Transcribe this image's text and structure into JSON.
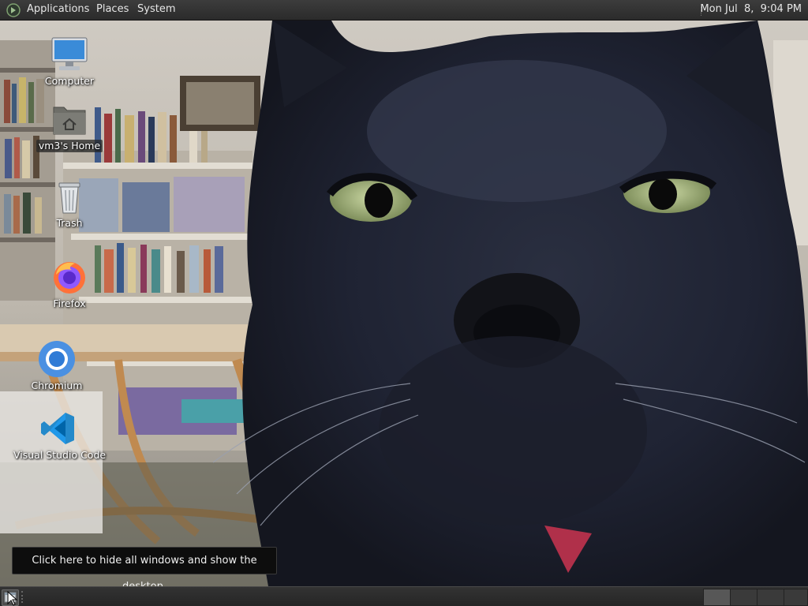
{
  "top_panel": {
    "menus": {
      "applications": "Applications",
      "places": "Places",
      "system": "System"
    },
    "clock": "Mon Jul  8,  9:04 PM"
  },
  "desktop": {
    "icons": [
      {
        "label": "Computer",
        "icon": "computer-icon"
      },
      {
        "label": "vm3's Home",
        "icon": "home-folder-icon"
      },
      {
        "label": "Trash",
        "icon": "trash-icon"
      },
      {
        "label": "Firefox",
        "icon": "firefox-icon"
      },
      {
        "label": "Chromium",
        "icon": "chromium-icon"
      },
      {
        "label": "Visual Studio Code",
        "icon": "vscode-icon"
      }
    ],
    "wallpaper": "black cat close-up in front of bookshelves"
  },
  "tooltip": {
    "text": "Click here to hide all windows and show the desktop."
  },
  "bottom_panel": {
    "show_desktop_icon": "show-desktop-icon",
    "workspaces": 4
  },
  "colors": {
    "panel": "#2f2f2f",
    "panel_text": "#e6e6e6",
    "firefox_orange": "#ff7139",
    "chromium_blue": "#4a90e2",
    "vscode_blue": "#2489ca"
  }
}
